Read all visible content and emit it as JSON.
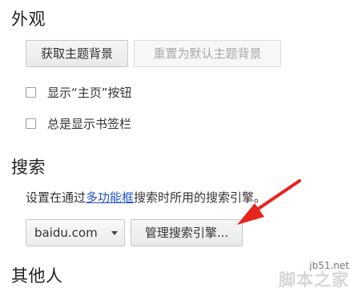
{
  "appearance": {
    "title": "外观",
    "get_theme_button": "获取主题背景",
    "reset_theme_button": "重置为默认主题背景",
    "show_home_button_label": "显示“主页”按钮",
    "show_bookmarks_bar_label": "总是显示书签栏",
    "show_home_button_checked": false,
    "show_bookmarks_bar_checked": false
  },
  "search": {
    "title": "搜索",
    "desc_before": "设置在通过",
    "desc_link": "多功能框",
    "desc_after": "搜索时所用的搜索引擎。",
    "engine_selected": "baidu.com",
    "manage_button": "管理搜索引擎..."
  },
  "others": {
    "title": "其他人"
  },
  "colors": {
    "link": "#2255cc",
    "arrow": "#e8231c"
  },
  "watermark": {
    "url": "jb51.net",
    "name": "脚本之家"
  }
}
